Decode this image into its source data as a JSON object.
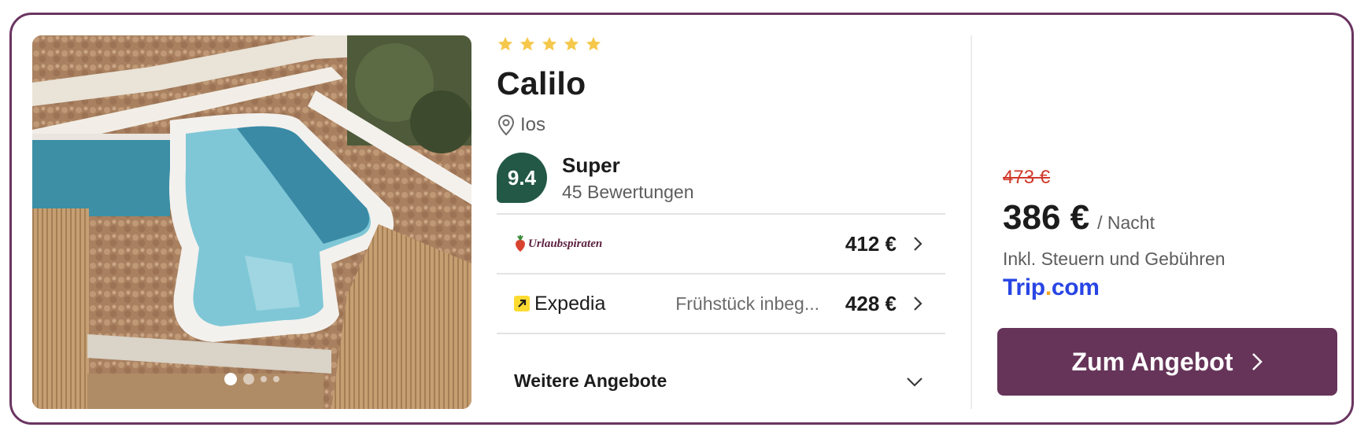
{
  "hotel": {
    "star_count": 5,
    "name": "Calilo",
    "location": "Ios",
    "score": "9.4",
    "score_label": "Super",
    "review_count": "45 Bewertungen"
  },
  "gallery": {
    "active_index": 0,
    "dot_count": 4
  },
  "offers": [
    {
      "provider": "Urlaubspiraten",
      "note": "",
      "price": "412 €"
    },
    {
      "provider": "Expedia",
      "note": "Frühstück inbeg...",
      "price": "428 €"
    }
  ],
  "more_offers_label": "Weitere Angebote",
  "deal": {
    "old_price": "473 €",
    "price": "386 €",
    "per_night": "/ Nacht",
    "tax_note": "Inkl. Steuern und Gebühren",
    "provider_name_part1": "Trip",
    "provider_name_dot": ".",
    "provider_name_part2": "com",
    "cta_label": "Zum Angebot"
  },
  "colors": {
    "brand": "#663459",
    "score_badge": "#235847",
    "star": "#f5c84c",
    "old_price": "#d0392b",
    "trip_blue": "#2845e4"
  }
}
